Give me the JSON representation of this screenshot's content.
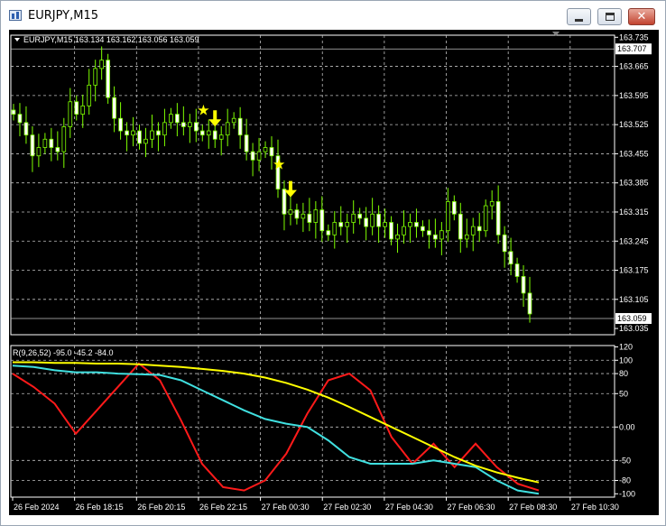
{
  "window": {
    "title": "EURJPY,M15"
  },
  "chart_header": "EURJPY,M15  163.134 163.162 163.056 163.059",
  "indicator_label": "R(9,26,52) -95.0 -45.2 -84.0",
  "colors": {
    "background": "#000000",
    "grid": "#c0c0c0",
    "candle": "#7fff00",
    "axis_text": "#ffffff",
    "star": "#ffff00",
    "arrow": "#ffff00",
    "line_fast": "#ff1a1a",
    "line_mid": "#40e0e0",
    "line_slow": "#ffff00"
  },
  "chart_data": [
    {
      "type": "candlestick",
      "symbol": "EURJPY",
      "timeframe": "M15",
      "price_axis_ticks": [
        "163.735",
        "163.665",
        "163.595",
        "163.525",
        "163.455",
        "163.385",
        "163.315",
        "163.245",
        "163.175",
        "163.105",
        "163.035"
      ],
      "price_axis_values": [
        163.735,
        163.665,
        163.595,
        163.525,
        163.455,
        163.385,
        163.315,
        163.245,
        163.175,
        163.105,
        163.035
      ],
      "ylim": [
        163.02,
        163.74
      ],
      "price_labels": [
        {
          "text": "163.707",
          "value": 163.707
        },
        {
          "text": "163.059",
          "value": 163.059
        }
      ],
      "time_labels": [
        "26 Feb 2024",
        "26 Feb 18:15",
        "26 Feb 20:15",
        "26 Feb 22:15",
        "27 Feb 00:30",
        "27 Feb 02:30",
        "27 Feb 04:30",
        "27 Feb 06:30",
        "27 Feb 08:30",
        "27 Feb 10:30"
      ],
      "closes": [
        163.55,
        163.53,
        163.5,
        163.45,
        163.47,
        163.49,
        163.47,
        163.46,
        163.52,
        163.58,
        163.55,
        163.57,
        163.62,
        163.66,
        163.68,
        163.59,
        163.54,
        163.51,
        163.5,
        163.51,
        163.48,
        163.49,
        163.51,
        163.5,
        163.53,
        163.55,
        163.53,
        163.52,
        163.53,
        163.51,
        163.5,
        163.51,
        163.49,
        163.5,
        163.53,
        163.54,
        163.5,
        163.46,
        163.44,
        163.46,
        163.47,
        163.45,
        163.37,
        163.31,
        163.32,
        163.3,
        163.31,
        163.29,
        163.32,
        163.27,
        163.26,
        163.29,
        163.28,
        163.29,
        163.31,
        163.3,
        163.28,
        163.31,
        163.28,
        163.29,
        163.25,
        163.26,
        163.28,
        163.29,
        163.28,
        163.27,
        163.26,
        163.25,
        163.27,
        163.34,
        163.31,
        163.25,
        163.26,
        163.28,
        163.27,
        163.33,
        163.34,
        163.26,
        163.22,
        163.19,
        163.16,
        163.12,
        163.07
      ],
      "signals": [
        {
          "type": "star",
          "bar": 30
        },
        {
          "type": "arrow-down",
          "bar": 32
        },
        {
          "type": "star",
          "bar": 42
        },
        {
          "type": "arrow-down",
          "bar": 44
        }
      ]
    },
    {
      "type": "line",
      "name": "R(9,26,52)",
      "yaxis_ticks": [
        "120",
        "100",
        "80",
        "50",
        "0.00",
        "-50",
        "-80",
        "-100"
      ],
      "yaxis_values": [
        120,
        100,
        80,
        50,
        0,
        -50,
        -80,
        -100
      ],
      "ylim": [
        -105,
        122
      ],
      "x": [
        0,
        4,
        8,
        12,
        16,
        20,
        24,
        28,
        32,
        36,
        40,
        44,
        48,
        52,
        56,
        60,
        64,
        68,
        72,
        76,
        80,
        84,
        88,
        92,
        96,
        100
      ],
      "series": [
        {
          "name": "",
          "color": "#ff1a1a",
          "values": [
            80,
            60,
            35,
            -10,
            25,
            60,
            95,
            70,
            10,
            -55,
            -90,
            -95,
            -80,
            -40,
            20,
            70,
            80,
            55,
            -15,
            -55,
            -25,
            -60,
            -25,
            -60,
            -85,
            -95
          ]
        },
        {
          "name": "",
          "color": "#40e0e0",
          "values": [
            92,
            90,
            85,
            82,
            82,
            80,
            79,
            78,
            70,
            55,
            40,
            25,
            12,
            5,
            0,
            -20,
            -45,
            -55,
            -55,
            -55,
            -50,
            -55,
            -60,
            -80,
            -95,
            -100
          ]
        },
        {
          "name": "",
          "color": "#ffff00",
          "values": [
            97,
            97,
            96,
            96,
            95,
            95,
            94,
            92,
            90,
            87,
            84,
            80,
            74,
            66,
            56,
            44,
            30,
            15,
            0,
            -15,
            -30,
            -45,
            -58,
            -68,
            -76,
            -83
          ]
        }
      ]
    }
  ]
}
